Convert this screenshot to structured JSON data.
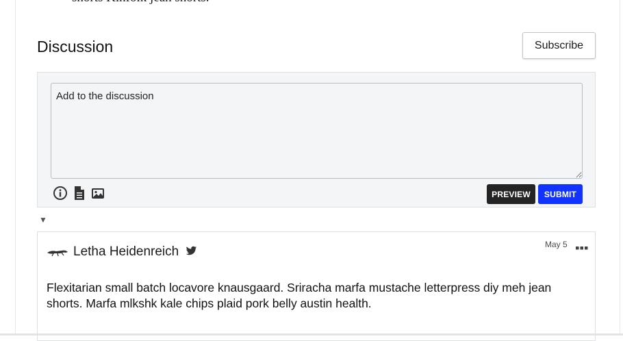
{
  "article": {
    "trailing_text": "shorts Kinfolk jean shorts."
  },
  "discussion": {
    "title": "Discussion",
    "subscribe_label": "Subscribe"
  },
  "composer": {
    "placeholder": "Add to the discussion",
    "toolbar_icons": [
      "info-icon",
      "document-icon",
      "image-icon"
    ],
    "preview_label": "PREVIEW",
    "submit_label": "SUBMIT",
    "colors": {
      "preview": "#242424",
      "submit": "#1033ff"
    }
  },
  "thread": {
    "collapse_glyph": "▼",
    "comments": [
      {
        "author": "Letha Heidenreich",
        "author_icons": [
          "avatar-icon",
          "twitter-icon"
        ],
        "date": "May 5",
        "more_glyph": "•••",
        "body": "Flexitarian small batch locavore knausgaard. Sriracha marfa mustache letterpress diy meh jean shorts. Marfa mlkshk kale chips plaid pork belly austin health."
      }
    ]
  }
}
